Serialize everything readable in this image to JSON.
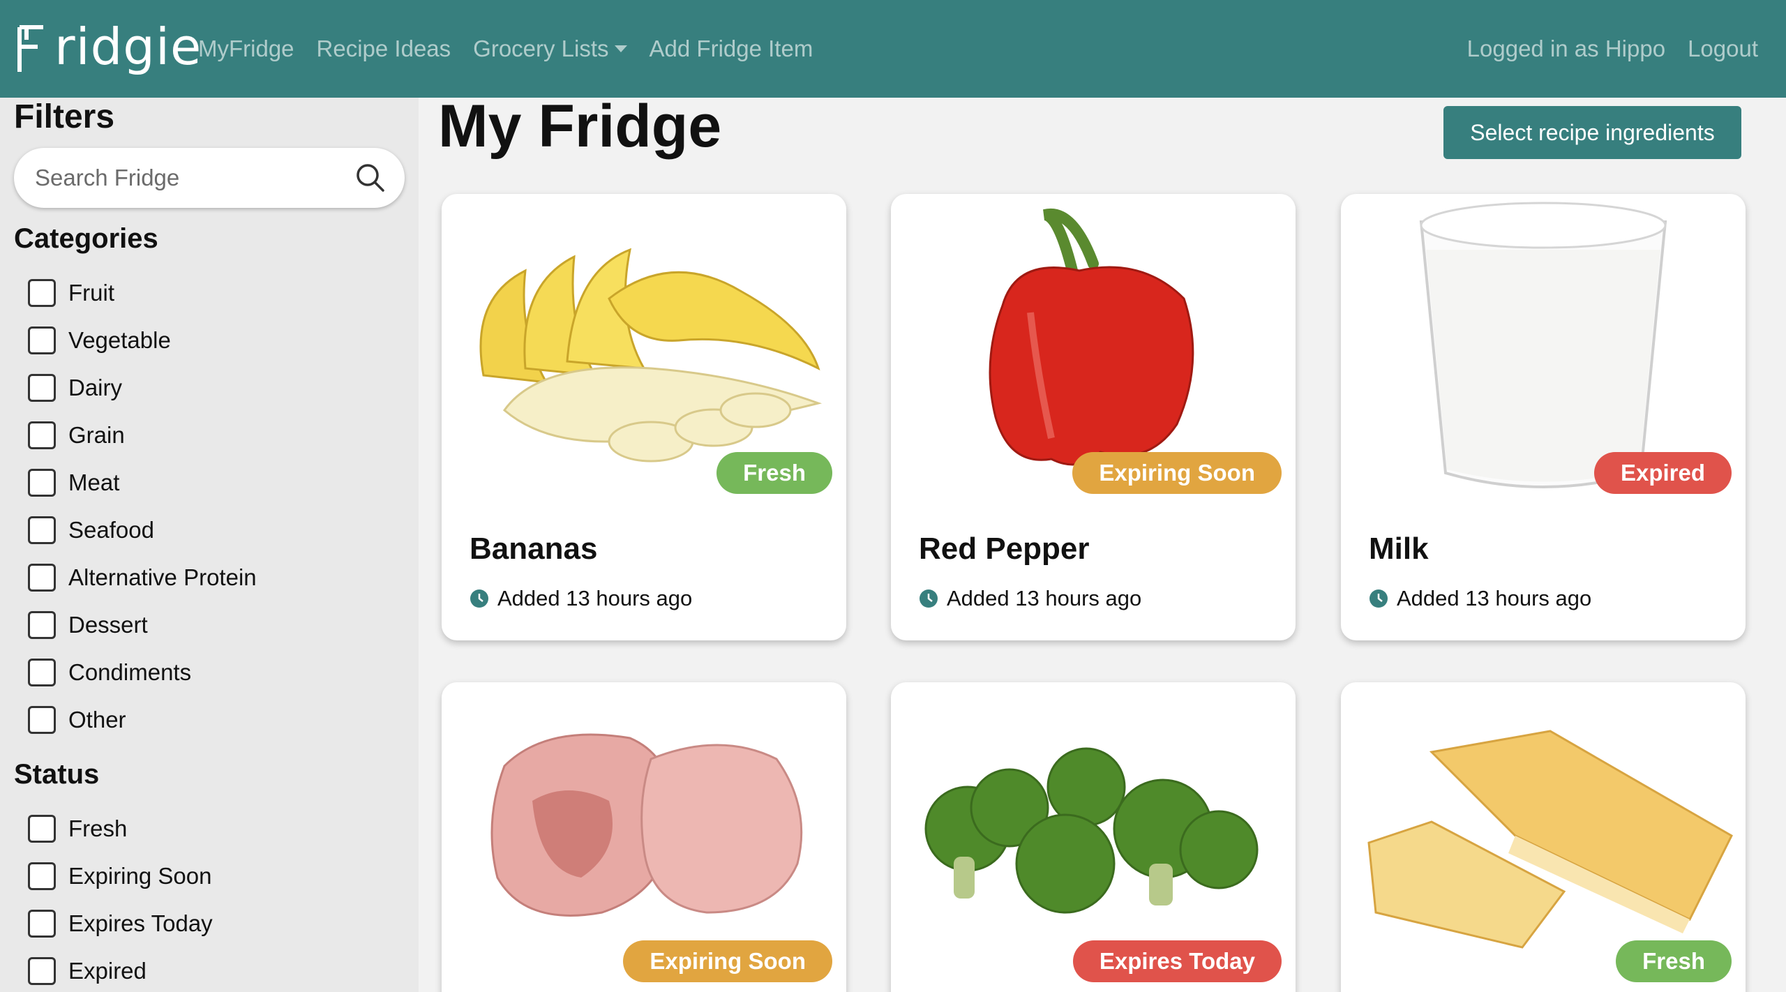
{
  "nav": {
    "brand": "Fridgie",
    "links": [
      "MyFridge",
      "Recipe Ideas",
      "Grocery Lists",
      "Add Fridge Item"
    ],
    "user": "Logged in as Hippo",
    "logout": "Logout"
  },
  "sidebar": {
    "filters_title": "Filters",
    "search_placeholder": "Search Fridge",
    "categories_title": "Categories",
    "categories": [
      "Fruit",
      "Vegetable",
      "Dairy",
      "Grain",
      "Meat",
      "Seafood",
      "Alternative Protein",
      "Dessert",
      "Condiments",
      "Other"
    ],
    "status_title": "Status",
    "statuses": [
      "Fresh",
      "Expiring Soon",
      "Expires Today",
      "Expired"
    ]
  },
  "main": {
    "title": "My Fridge",
    "select_button": "Select recipe ingredients",
    "cards": [
      {
        "name": "Bananas",
        "added": "Added 13 hours ago",
        "status": "Fresh",
        "image": "bananas-image"
      },
      {
        "name": "Red Pepper",
        "added": "Added 13 hours ago",
        "status": "Expiring Soon",
        "image": "red-pepper-image"
      },
      {
        "name": "Milk",
        "added": "Added 13 hours ago",
        "status": "Expired",
        "image": "milk-image"
      },
      {
        "name": "",
        "added": "",
        "status": "Expiring Soon",
        "image": "pork-chops-image"
      },
      {
        "name": "",
        "added": "",
        "status": "Expires Today",
        "image": "broccoli-image"
      },
      {
        "name": "",
        "added": "",
        "status": "Fresh",
        "image": "pound-cake-image"
      }
    ]
  },
  "colors": {
    "brand_teal": "#377f7e",
    "fresh": "#76b85a",
    "expiring_soon": "#e1a540",
    "expired": "#e0534b"
  }
}
